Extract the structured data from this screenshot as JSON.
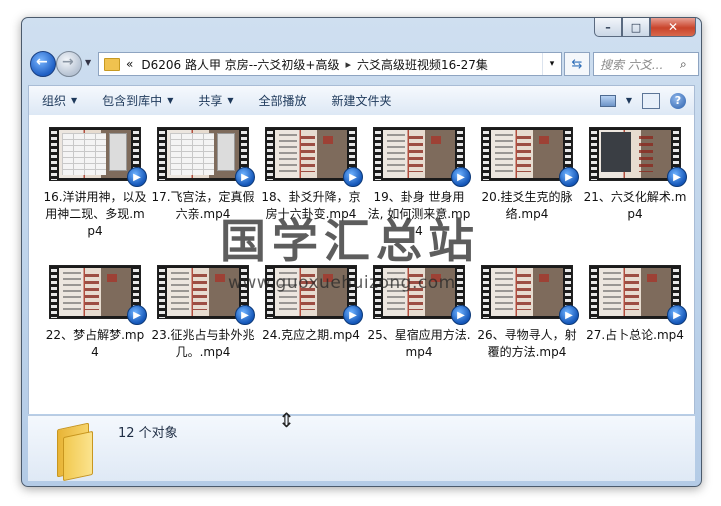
{
  "window": {
    "caption_buttons": {
      "minimize": "–",
      "maximize": "□",
      "close": "✕"
    }
  },
  "address": {
    "recent_arrow": "▼",
    "prefix": "«",
    "crumbs": [
      "D6206 路人甲 京房--六爻初级+高级",
      "六爻高级班视频16-27集"
    ],
    "separator": "▸",
    "dropdown": "▾",
    "refresh_glyph": "⇆",
    "search_placeholder": "搜索 六爻...",
    "search_icon": "magnifier-icon"
  },
  "toolbar": {
    "organize": "组织",
    "include_library": "包含到库中",
    "share": "共享",
    "play_all": "全部播放",
    "new_folder": "新建文件夹",
    "dropdown_arrow": "▼",
    "help": "?"
  },
  "files": [
    {
      "name": "16.洋讲用神，以及用神二现、多现.mp4",
      "thumb": "grid"
    },
    {
      "name": "17.飞宫法，定真假六亲.mp4",
      "thumb": "grid"
    },
    {
      "name": "18、卦爻升降，京房十六卦变.mp4",
      "thumb": "calli"
    },
    {
      "name": "19、卦身  世身用法, 如何测来意.mp4",
      "thumb": "calli"
    },
    {
      "name": "20.挂爻生克的脉络.mp4",
      "thumb": "calli"
    },
    {
      "name": "21、六爻化解术.mp4",
      "thumb": "dark"
    },
    {
      "name": "22、梦占解梦.mp4",
      "thumb": "calli"
    },
    {
      "name": "23.征兆占与卦外兆几。.mp4",
      "thumb": "calli"
    },
    {
      "name": "24.克应之期.mp4",
      "thumb": "calli"
    },
    {
      "name": "25、星宿应用方法.mp4",
      "thumb": "calli"
    },
    {
      "name": "26、寻物寻人，射覆的方法.mp4",
      "thumb": "calli"
    },
    {
      "name": "27.占卜总论.mp4",
      "thumb": "calli"
    }
  ],
  "media_badge_glyph": "▶",
  "details": {
    "count": "12 个对象"
  },
  "watermark": {
    "text": "国学汇总站",
    "url": "www.guoxuehuizong.com"
  },
  "cursor_glyph": "⇕"
}
